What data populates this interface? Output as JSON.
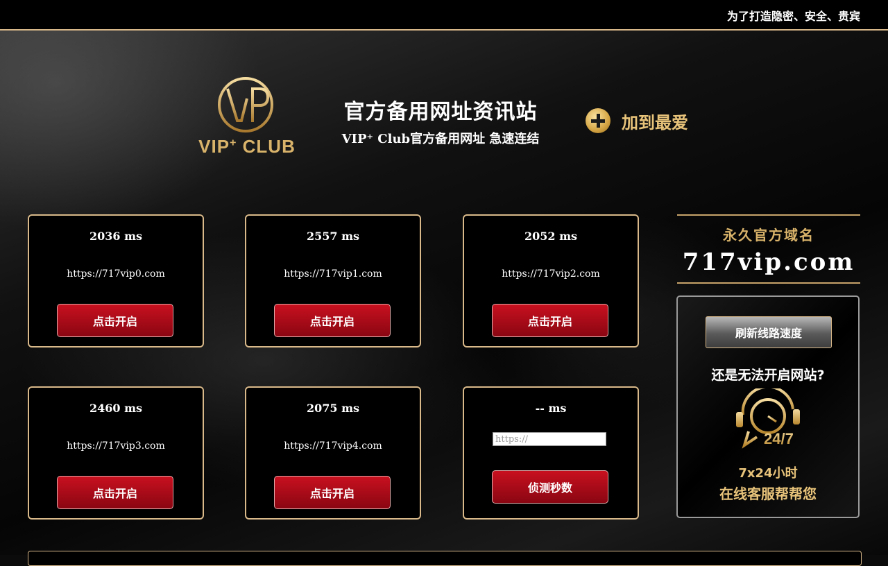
{
  "header": {
    "tagline": "为了打造隐密、安全、贵宾"
  },
  "brand": {
    "logo_text": "VIP",
    "logo_sup": "+",
    "logo_club": " CLUB",
    "title": "官方备用网址资讯站",
    "subtitle": "VIP⁺ Club官方备用网址 急速连结",
    "favorite_label": "加到最爱"
  },
  "lines": [
    {
      "ms": "2036 ms",
      "url": "https://717vip0.com",
      "button": "点击开启"
    },
    {
      "ms": "2557 ms",
      "url": "https://717vip1.com",
      "button": "点击开启"
    },
    {
      "ms": "2052 ms",
      "url": "https://717vip2.com",
      "button": "点击开启"
    },
    {
      "ms": "2460 ms",
      "url": "https://717vip3.com",
      "button": "点击开启"
    },
    {
      "ms": "2075 ms",
      "url": "https://717vip4.com",
      "button": "点击开启"
    }
  ],
  "custom_line": {
    "ms": "-- ms",
    "placeholder": "https://",
    "button": "侦测秒数"
  },
  "domain": {
    "label": "永久官方域名",
    "value": "717vip.com"
  },
  "support": {
    "refresh_button": "刷新线路速度",
    "question": "还是无法开启网站?",
    "clock_label": "24/7",
    "hours": "7x24小时",
    "help": "在线客服帮帮您"
  },
  "colors": {
    "accent_gold": "#d9b98a",
    "button_red": "#c8101f",
    "text_gold": "#e8c37a"
  }
}
